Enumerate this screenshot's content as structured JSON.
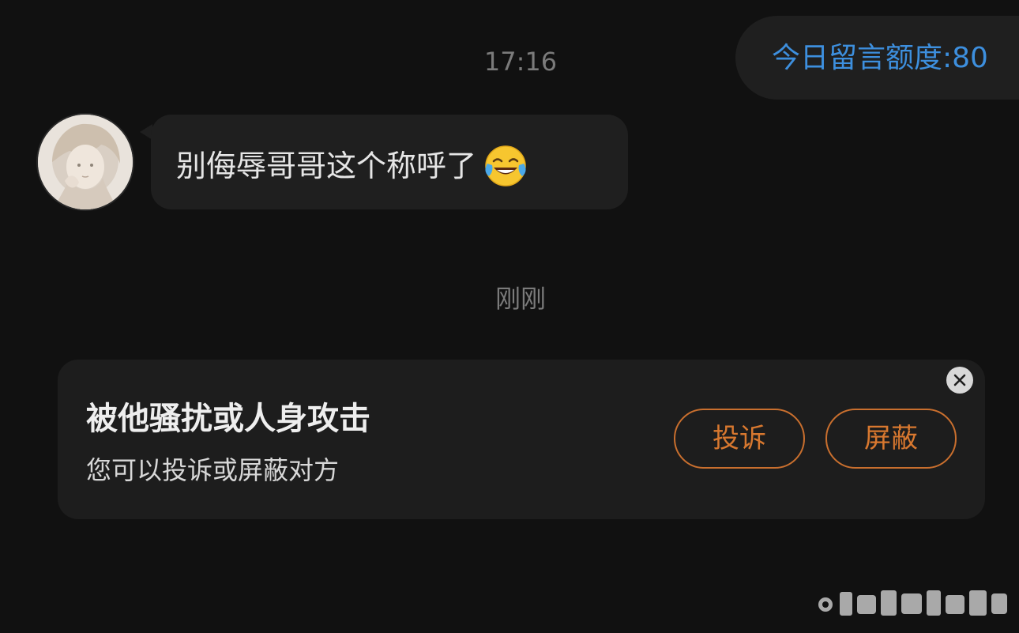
{
  "chat": {
    "quota_text": "今日留言额度:80",
    "timestamp_1": "17:16",
    "timestamp_2": "刚刚",
    "incoming_message": "别侮辱哥哥这个称呼了",
    "incoming_message_emoji": "face-with-tears-of-joy-emoji"
  },
  "report_card": {
    "title": "被他骚扰或人身攻击",
    "subtitle": "您可以投诉或屏蔽对方",
    "report_label": "投诉",
    "block_label": "屏蔽",
    "close_icon": "close-icon"
  },
  "colors": {
    "background": "#111111",
    "bubble": "#1f1f1f",
    "quota_text": "#3d8fde",
    "accent_orange": "#d8782f"
  }
}
